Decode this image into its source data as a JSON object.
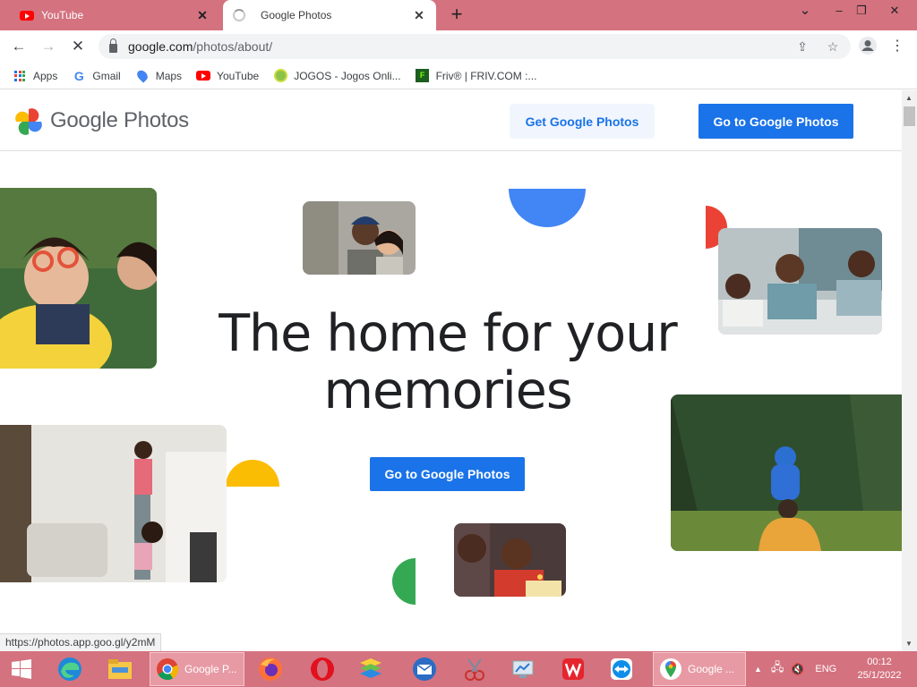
{
  "browser": {
    "tabs": [
      {
        "title": "YouTube",
        "active": false
      },
      {
        "title": "Google Photos",
        "active": true
      }
    ],
    "new_tab": "+",
    "window_controls": {
      "dropdown": "⌄",
      "minimize": "–",
      "restore": "❐",
      "close": "✕"
    },
    "url_domain": "google.com",
    "url_path": "/photos/about/",
    "bookmarks": [
      {
        "label": "Apps",
        "icon": "apps-grid-icon"
      },
      {
        "label": "Gmail",
        "icon": "google-g-icon"
      },
      {
        "label": "Maps",
        "icon": "maps-pin-icon"
      },
      {
        "label": "YouTube",
        "icon": "youtube-icon"
      },
      {
        "label": "JOGOS - Jogos Onli...",
        "icon": "jogos-icon"
      },
      {
        "label": "Friv® | FRIV.COM :...",
        "icon": "friv-icon"
      }
    ],
    "status_url": "https://photos.app.goo.gl/y2mM"
  },
  "page": {
    "brand": "Google Photos",
    "get_button": "Get Google Photos",
    "go_button": "Go to Google Photos",
    "headline_line1": "The home for your",
    "headline_line2": "memories",
    "hero_button": "Go to Google Photos"
  },
  "taskbar": {
    "chrome_label": "Google P...",
    "maps_label": "Google ...",
    "language": "ENG",
    "time": "00:12",
    "date": "25/1/2022"
  },
  "colors": {
    "accent_blue": "#1a73e8",
    "chrome_frame": "#d4727f",
    "google_yellow": "#fbbc04",
    "google_red": "#ea4335",
    "google_green": "#34a853",
    "google_blue": "#4285f4"
  }
}
